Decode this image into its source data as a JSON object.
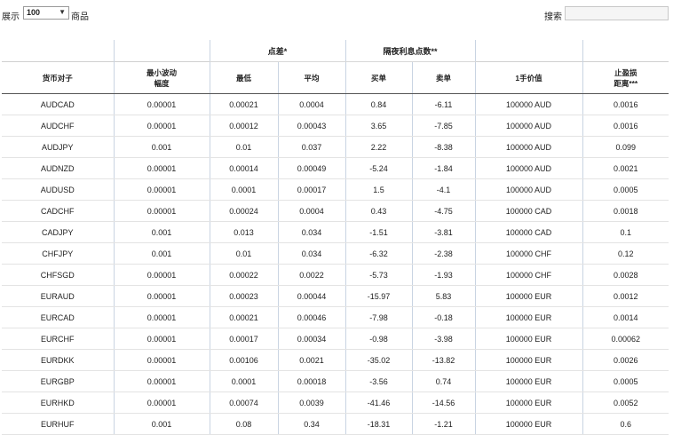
{
  "toolbar": {
    "show_label": "展示",
    "page_size": "100",
    "items_label": "商品",
    "search_label": "搜索",
    "search_value": ""
  },
  "table": {
    "group_headers": {
      "spread": "点差*",
      "swap": "隔夜利息点数**"
    },
    "columns": {
      "pair": "货币对子",
      "min_move_1": "最小波动",
      "min_move_2": "幅度",
      "lowest": "最低",
      "average": "平均",
      "buy": "买单",
      "sell": "卖单",
      "lot_value": "1手价值",
      "stop_1": "止盈损",
      "stop_2": "距离***"
    },
    "rows": [
      [
        "AUDCAD",
        "0.00001",
        "0.00021",
        "0.0004",
        "0.84",
        "-6.11",
        "100000 AUD",
        "0.0016"
      ],
      [
        "AUDCHF",
        "0.00001",
        "0.00012",
        "0.00043",
        "3.65",
        "-7.85",
        "100000 AUD",
        "0.0016"
      ],
      [
        "AUDJPY",
        "0.001",
        "0.01",
        "0.037",
        "2.22",
        "-8.38",
        "100000 AUD",
        "0.099"
      ],
      [
        "AUDNZD",
        "0.00001",
        "0.00014",
        "0.00049",
        "-5.24",
        "-1.84",
        "100000 AUD",
        "0.0021"
      ],
      [
        "AUDUSD",
        "0.00001",
        "0.0001",
        "0.00017",
        "1.5",
        "-4.1",
        "100000 AUD",
        "0.0005"
      ],
      [
        "CADCHF",
        "0.00001",
        "0.00024",
        "0.0004",
        "0.43",
        "-4.75",
        "100000 CAD",
        "0.0018"
      ],
      [
        "CADJPY",
        "0.001",
        "0.013",
        "0.034",
        "-1.51",
        "-3.81",
        "100000 CAD",
        "0.1"
      ],
      [
        "CHFJPY",
        "0.001",
        "0.01",
        "0.034",
        "-6.32",
        "-2.38",
        "100000 CHF",
        "0.12"
      ],
      [
        "CHFSGD",
        "0.00001",
        "0.00022",
        "0.0022",
        "-5.73",
        "-1.93",
        "100000 CHF",
        "0.0028"
      ],
      [
        "EURAUD",
        "0.00001",
        "0.00023",
        "0.00044",
        "-15.97",
        "5.83",
        "100000 EUR",
        "0.0012"
      ],
      [
        "EURCAD",
        "0.00001",
        "0.00021",
        "0.00046",
        "-7.98",
        "-0.18",
        "100000 EUR",
        "0.0014"
      ],
      [
        "EURCHF",
        "0.00001",
        "0.00017",
        "0.00034",
        "-0.98",
        "-3.98",
        "100000 EUR",
        "0.00062"
      ],
      [
        "EURDKK",
        "0.00001",
        "0.00106",
        "0.0021",
        "-35.02",
        "-13.82",
        "100000 EUR",
        "0.0026"
      ],
      [
        "EURGBP",
        "0.00001",
        "0.0001",
        "0.00018",
        "-3.56",
        "0.74",
        "100000 EUR",
        "0.0005"
      ],
      [
        "EURHKD",
        "0.00001",
        "0.00074",
        "0.0039",
        "-41.46",
        "-14.56",
        "100000 EUR",
        "0.0052"
      ],
      [
        "EURHUF",
        "0.001",
        "0.08",
        "0.34",
        "-18.31",
        "-1.21",
        "100000 EUR",
        "0.6"
      ]
    ]
  }
}
